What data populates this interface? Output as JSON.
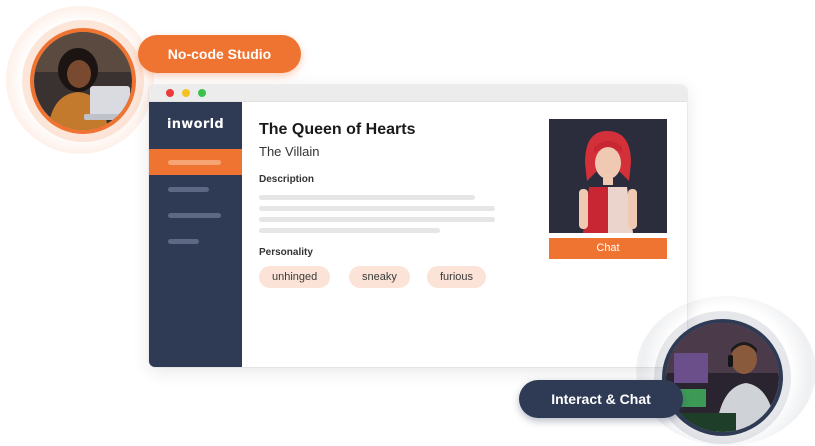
{
  "badges": {
    "studio_label": "No-code Studio",
    "chat_label": "Interact & Chat"
  },
  "app": {
    "logo": "inworld",
    "window_controls": [
      "close",
      "minimize",
      "maximize"
    ]
  },
  "character": {
    "name": "The Queen of Hearts",
    "role": "The Villain",
    "description_label": "Description",
    "personality_label": "Personality",
    "personality_tags": [
      "unhinged",
      "sneaky",
      "furious"
    ],
    "chat_button": "Chat"
  },
  "colors": {
    "accent": "#f07431",
    "sidebar": "#2f3b55",
    "tag_bg": "#fbe3d7"
  },
  "icons": {
    "window_close": "red-dot-icon",
    "window_minimize": "yellow-dot-icon",
    "window_maximize": "green-dot-icon"
  }
}
